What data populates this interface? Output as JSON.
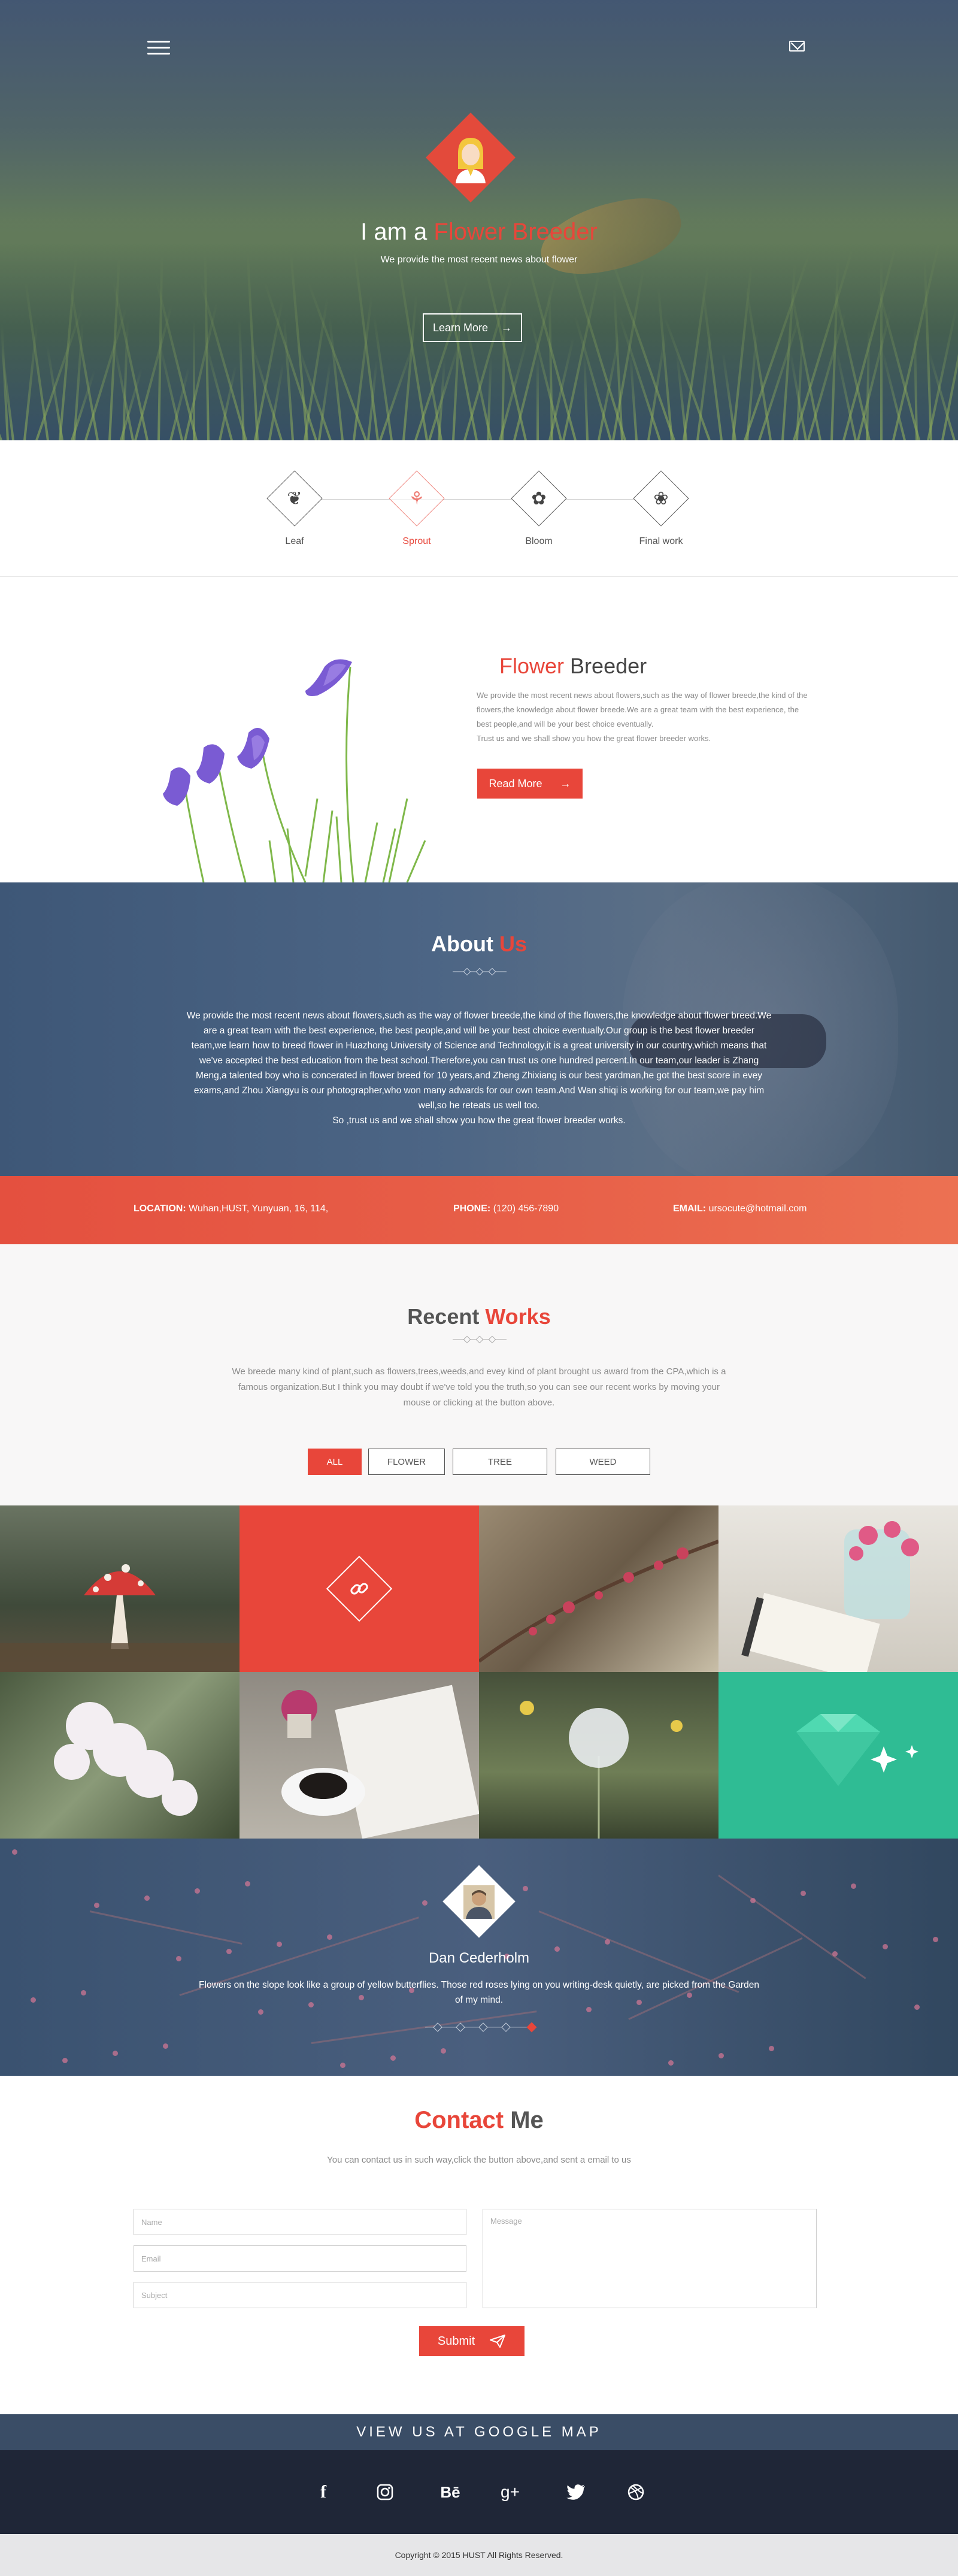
{
  "hero": {
    "title_prefix": "I am a",
    "title_accent": "Flower Breeder",
    "subtitle": "We provide the most recent news about flower",
    "button_label": "Learn More",
    "button_arrow": "→"
  },
  "process": {
    "steps": [
      {
        "label": "Leaf",
        "icon": "leaf-icon",
        "glyph": "❦"
      },
      {
        "label": "Sprout",
        "icon": "sprout-icon",
        "glyph": "⚘"
      },
      {
        "label": "Bloom",
        "icon": "potted-plant-icon",
        "glyph": "✿"
      },
      {
        "label": "Final work",
        "icon": "rose-icon",
        "glyph": "❀"
      }
    ]
  },
  "breeder": {
    "title_accent": "Flower",
    "title_rest": "Breeder",
    "paragraph": "We provide the most recent news about flowers,such as the  way of flower breede,the kind of the flowers,the knowledge about flower breede.We are a great team with the best experience, the best people,and will be your best choice eventually.",
    "paragraph2": "Trust us and we shall show you how the great flower breeder works.",
    "button_label": "Read More",
    "button_arrow": "→"
  },
  "about": {
    "title": "About",
    "title_accent": "Us",
    "text": "We provide the most recent news about flowers,such as the  way of flower breede,the kind of the flowers,the knowledge about flower breed.We are a great team with the best experience, the best people,and will be your best choice eventually.Our group is the best flower breeder team,we learn how to breed flower in Huazhong University of Science and Technology,it is a great university in our country,which means that we've accepted the best education from the best school.Therefore,you can trust us one hundred percent.In our team,our leader is Zhang Meng,a talented boy who is concerated in flower breed for 10 years,and Zheng Zhixiang is our best yardman,he got the best score in evey exams,and Zhou Xiangyu is our photographer,who won many adwards for our own team.And Wan shiqi is working for our team,we pay him well,so he reteats us well too.",
    "text_last": "So ,trust us and we shall show you how the great flower breeder works."
  },
  "info": {
    "location_label": "LOCATION:",
    "location_value": "Wuhan,HUST, Yunyuan, 16, 114,",
    "phone_label": "PHONE:",
    "phone_value": "(120) 456-7890",
    "email_label": "EMAIL:",
    "email_value": "ursocute@hotmail.com"
  },
  "works": {
    "title": "Recent",
    "title_accent": "Works",
    "text": "We breede many kind of plant,such as flowers,trees,weeds,and evey kind of plant brought us award from the CPA,which is a famous organization.But I think you may doubt if we've told you the truth,so you can see our recent works by moving your mouse or clicking at the button above.",
    "filters": [
      "ALL",
      "FLOWER",
      "TREE",
      "WEED"
    ]
  },
  "testimonial": {
    "name": "Dan Cederholm",
    "quote": "Flowers on the slope look like a group of yellow butterflies. Those red roses lying on you writing-desk quietly, are picked from the Garden of my mind."
  },
  "contact": {
    "title_accent": "Contact",
    "title_rest": "Me",
    "subtitle": "You can contact us in such way,click the button above,and sent a email to us",
    "name_placeholder": "Name",
    "email_placeholder": "Email",
    "subject_placeholder": "Subject",
    "message_placeholder": "Message",
    "submit_label": "Submit",
    "submit_icon": "paper-plane-icon"
  },
  "map": {
    "label": "VIEW US AT GOOGLE MAP"
  },
  "social": {
    "items": [
      {
        "name": "facebook-icon",
        "glyph": "f"
      },
      {
        "name": "instagram-icon",
        "glyph": "◘"
      },
      {
        "name": "behance-icon",
        "glyph": "Bē"
      },
      {
        "name": "google-plus-icon",
        "glyph": "g+"
      },
      {
        "name": "twitter-icon",
        "glyph": "🐦"
      },
      {
        "name": "dribbble-icon",
        "glyph": "◎"
      }
    ]
  },
  "footer": {
    "copyright": "Copyright © 2015 HUST All Rights Reserved."
  },
  "colors": {
    "accent": "#e8463a",
    "dark_blue": "#3a4d66",
    "footer_dark": "#1f2637"
  }
}
